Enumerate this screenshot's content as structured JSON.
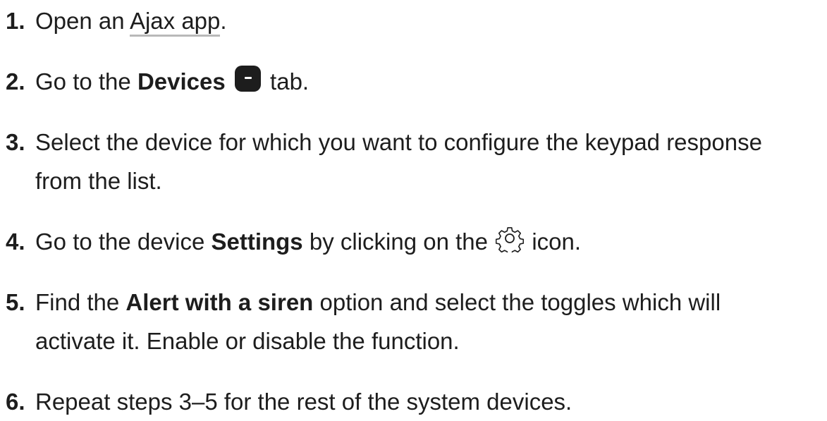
{
  "steps": [
    {
      "number": "1.",
      "before": "Open an ",
      "link": "Ajax app",
      "after": "."
    },
    {
      "number": "2.",
      "before": "Go to the ",
      "bold": "Devices",
      "icon": "devices-tab-icon",
      "after": " tab."
    },
    {
      "number": "3.",
      "line1": "Select the device for which you want to configure the keypad response",
      "line2": "from the list."
    },
    {
      "number": "4.",
      "before": "Go to the device ",
      "bold": "Settings",
      "middle": " by clicking on the ",
      "icon": "gear-icon",
      "after": " icon."
    },
    {
      "number": "5.",
      "before": "Find the ",
      "bold": "Alert with a siren",
      "line1_after": " option and select the toggles which will",
      "line2": "activate it. Enable or disable the function."
    },
    {
      "number": "6.",
      "text": "Repeat steps 3–5 for the rest of the system devices."
    }
  ]
}
